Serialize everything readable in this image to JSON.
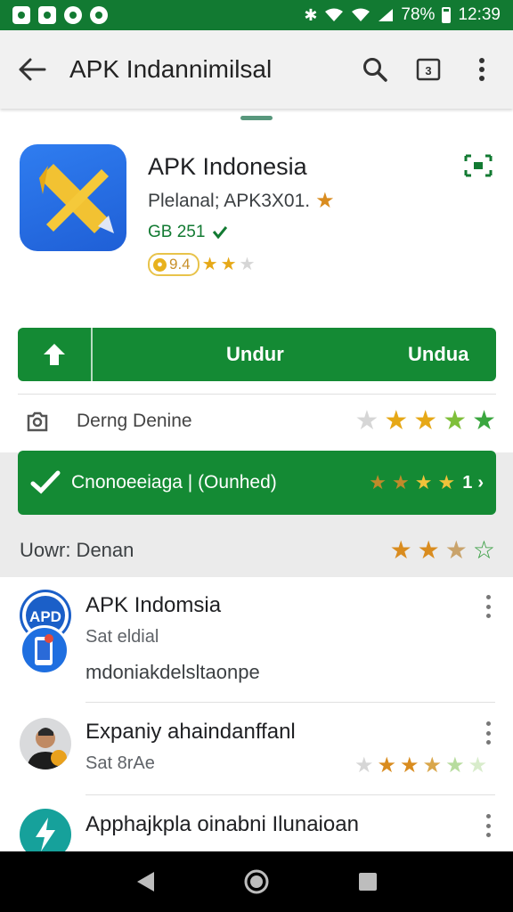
{
  "status_bar": {
    "battery": "78%",
    "time": "12:39"
  },
  "toolbar": {
    "title": "APK Indannimilsal",
    "icons": [
      "back-arrow-icon",
      "search-icon",
      "tab-icon",
      "more-vert-icon"
    ]
  },
  "app": {
    "name": "APK Indonesia",
    "subtitle": "Plelanal; APK3X01.",
    "size": "GB 251",
    "rating_value": "9.4"
  },
  "install": {
    "label_1": "Undur",
    "label_2": "Undua"
  },
  "developer_row": {
    "label": "Derng Denine"
  },
  "banner": {
    "text": "Cnonoeeiaga |   (Ounhed)",
    "value": "1"
  },
  "reviews_row": {
    "label": "Uowr: Denan"
  },
  "list": [
    {
      "title": "APK Indomsia",
      "sub1": "Sat eldial",
      "sub2": "mdoniakdelsltaonpe"
    },
    {
      "title": "Expaniy ahaindanffanl",
      "sub1": "Sat 8rAe"
    },
    {
      "title": "Apphajkpla oinabni Ilunaioan",
      "sub1": ""
    }
  ],
  "colors": {
    "status_green": "#127a32",
    "button_green": "#148a34",
    "star_gold": "#e6a817"
  }
}
